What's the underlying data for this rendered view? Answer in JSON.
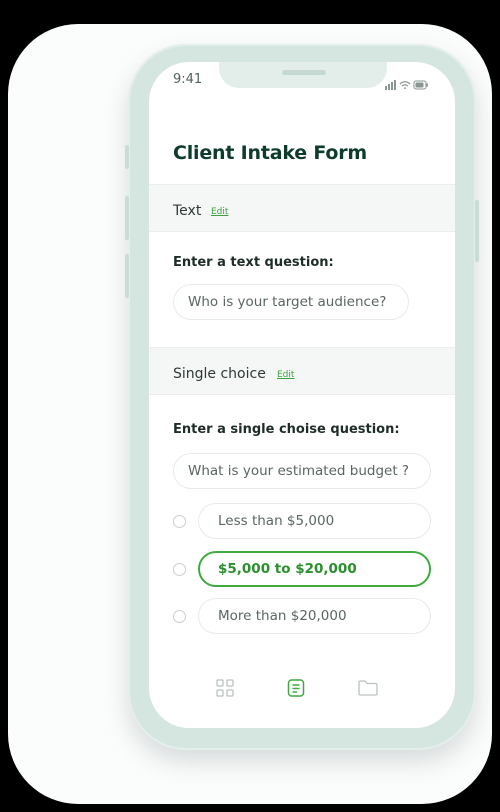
{
  "status_bar": {
    "time": "9:41"
  },
  "form": {
    "title": "Client Intake Form",
    "sections": [
      {
        "type": "Text",
        "edit_label": "Edit",
        "question_label": "Enter a text question:",
        "input_value": "Who is your target audience?"
      },
      {
        "type": "Single choice",
        "edit_label": "Edit",
        "question_label": "Enter a single choise question:",
        "input_value": "What is your estimated budget ?",
        "options": [
          {
            "label": "Less than $5,000",
            "selected": false
          },
          {
            "label": "$5,000 to $20,000",
            "selected": true
          },
          {
            "label": "More than $20,000",
            "selected": false
          }
        ]
      }
    ]
  },
  "tab_bar": {
    "icons": [
      "grid-icon",
      "document-icon",
      "folder-icon"
    ],
    "active": "document-icon"
  },
  "colors": {
    "accent": "#3eaa3f",
    "title": "#0d3b2c",
    "phone_frame": "#d5e6e0"
  }
}
